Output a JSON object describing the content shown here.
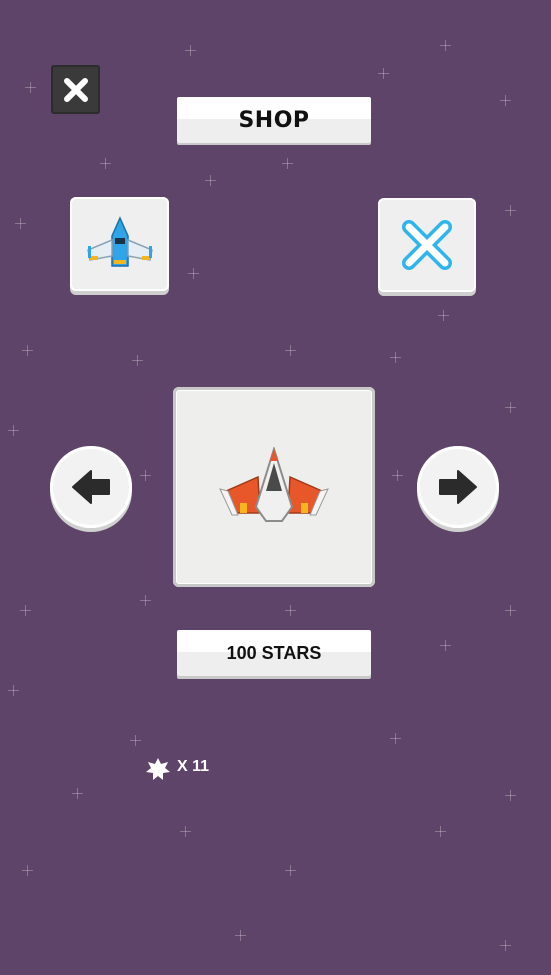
{
  "shop": {
    "title": "SHOP",
    "price_label": "100 STARS"
  },
  "wallet": {
    "count_label": "X 11",
    "icon": "star-badge-icon"
  },
  "icons": {
    "close": "close-icon",
    "left_tile": "blue-ship-icon",
    "right_tile": "blue-x-icon",
    "preview": "orange-ship-icon",
    "prev": "arrow-left-icon",
    "next": "arrow-right-icon"
  },
  "colors": {
    "background": "#5e4469",
    "button_light": "#efefef",
    "close_button": "#3a3a3a",
    "ship_orange": "#e8572a",
    "ship_blue": "#2fa4e7",
    "accent_yellow": "#f3b61f"
  }
}
